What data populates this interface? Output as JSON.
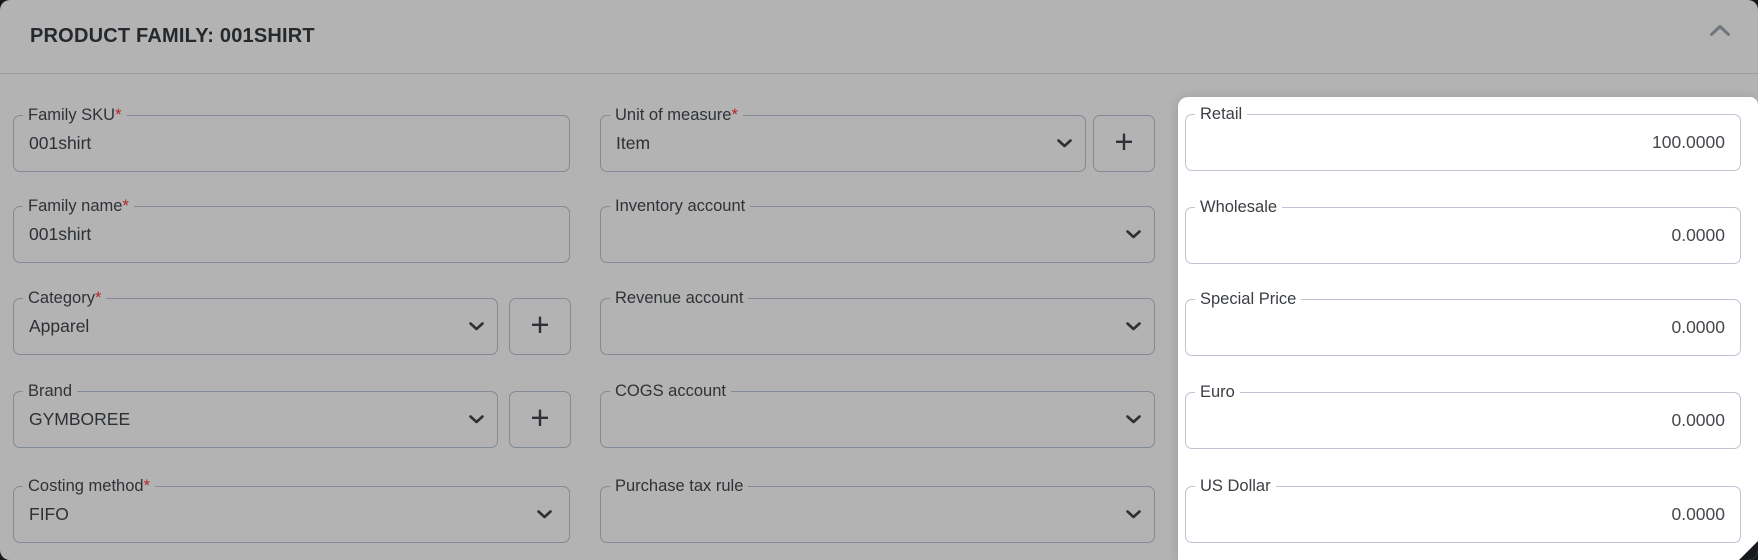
{
  "header": {
    "title": "PRODUCT FAMILY: 001SHIRT",
    "collapse_icon": "chevron-up-icon"
  },
  "form": {
    "left_column": [
      {
        "label": "Family SKU",
        "mark": "*",
        "value": "001shirt",
        "type": "text"
      },
      {
        "label": "Family name",
        "mark": "*",
        "value": "001shirt",
        "type": "text"
      },
      {
        "label": "Category",
        "mark": "*",
        "value": "Apparel",
        "type": "select",
        "add_button_label": "+"
      },
      {
        "label": "Brand",
        "value": "GYMBOREE",
        "type": "select",
        "add_button_label": "+"
      },
      {
        "label": "Costing method",
        "mark": "*",
        "value": "FIFO",
        "type": "select"
      }
    ],
    "middle_column": [
      {
        "label": "Unit of measure",
        "mark": "*",
        "value": "Item",
        "type": "select",
        "add_button_label": "+"
      },
      {
        "label": "Inventory account",
        "value": "",
        "type": "select"
      },
      {
        "label": "Revenue account",
        "value": "",
        "type": "select"
      },
      {
        "label": "COGS account",
        "value": "",
        "type": "select"
      },
      {
        "label": "Purchase tax rule",
        "value": "",
        "type": "select"
      }
    ],
    "price_panel": [
      {
        "label": "Retail",
        "value": "100.0000"
      },
      {
        "label": "Wholesale",
        "value": "0.0000"
      },
      {
        "label": "Special Price",
        "value": "0.0000"
      },
      {
        "label": "Euro",
        "value": "0.0000"
      },
      {
        "label": "US Dollar",
        "value": "0.0000"
      }
    ]
  },
  "icons": {
    "select_indicator": "chevron-down-icon",
    "header_collapse": "chevron-up-icon",
    "corner": "resize-handle"
  },
  "colors": {
    "card_background": "#b2b3b2",
    "panel_background": "#ffffff",
    "field_border_gray": "#828a95",
    "field_border_white": "#bfc3d2",
    "text_primary": "#2d3035",
    "required_red": "#b8232a",
    "header_divider": "#9b9b9b"
  }
}
